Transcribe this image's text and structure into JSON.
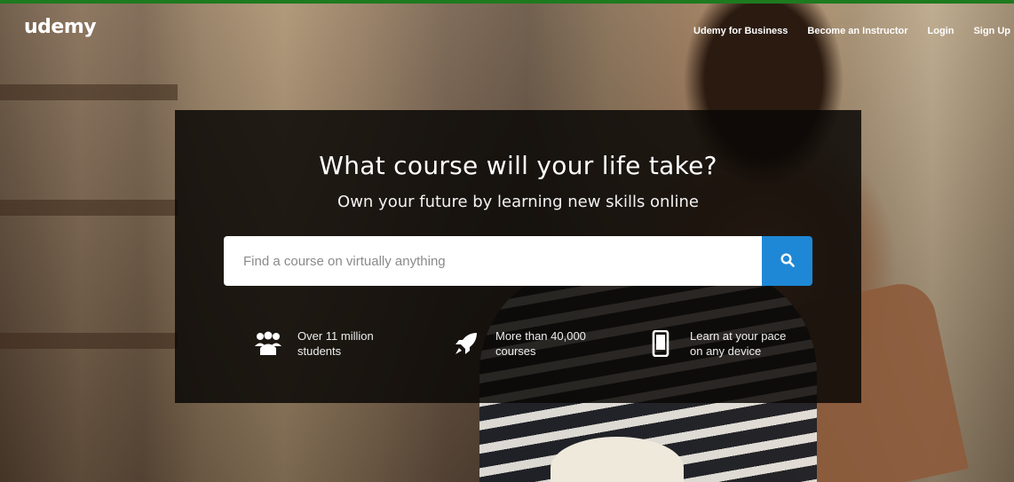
{
  "brand": {
    "logo_text": "udemy",
    "accent_color": "#1e7a1e",
    "primary_blue": "#1e88d6"
  },
  "nav": {
    "links": [
      {
        "label": "Udemy for Business"
      },
      {
        "label": "Become an Instructor"
      },
      {
        "label": "Login"
      },
      {
        "label": "Sign Up"
      }
    ]
  },
  "hero": {
    "title": "What course will your life take?",
    "subtitle": "Own your future by learning new skills online",
    "search": {
      "placeholder": "Find a course on virtually anything",
      "value": "",
      "button_icon": "search-icon"
    },
    "features": [
      {
        "icon": "students-icon",
        "line1": "Over 11 million",
        "line2": "students"
      },
      {
        "icon": "rocket-icon",
        "line1": "More than 40,000",
        "line2": "courses"
      },
      {
        "icon": "mobile-device-icon",
        "line1": "Learn at your pace",
        "line2": "on any device"
      }
    ]
  }
}
